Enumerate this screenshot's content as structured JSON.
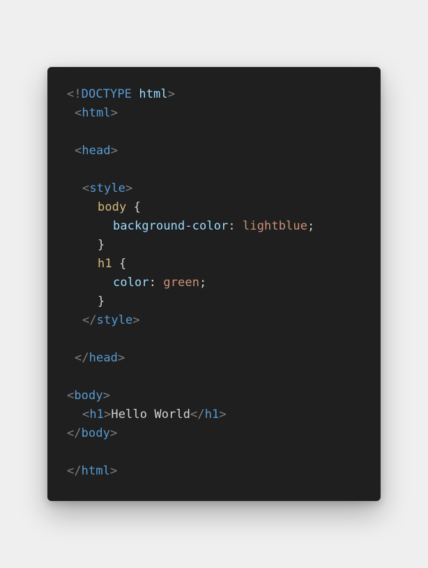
{
  "code": {
    "doctype_open": "<!",
    "doctype_keyword": "DOCTYPE",
    "doctype_space": " ",
    "doctype_value": "html",
    "doctype_close": ">",
    "lt": "<",
    "gt": ">",
    "lt_slash": "</",
    "tag_html": "html",
    "tag_head": "head",
    "tag_style": "style",
    "tag_body": "body",
    "tag_h1": "h1",
    "selector_body": "body",
    "selector_h1": "h1",
    "brace_open": " {",
    "brace_close": "}",
    "prop_background": "background-color",
    "prop_color": "color",
    "colon_space": ": ",
    "value_lightblue": "lightblue",
    "value_green": "green",
    "semicolon": ";",
    "h1_text": "Hello World"
  },
  "colors": {
    "background": "#efefef",
    "card": "#1f1f1f",
    "tag": "#569cd6",
    "punctuation": "#808080",
    "property": "#9cdcfe",
    "selector": "#d7ba7d",
    "value": "#ce9178",
    "text": "#d4d4d4"
  }
}
